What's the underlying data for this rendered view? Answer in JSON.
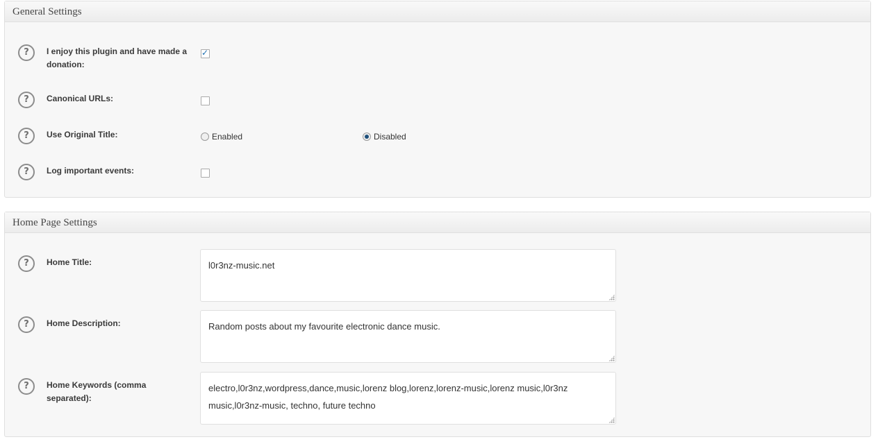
{
  "general": {
    "title": "General Settings",
    "donation": {
      "label": "I enjoy this plugin and have made a donation:",
      "checked": true
    },
    "canonical": {
      "label": "Canonical URLs:",
      "checked": false
    },
    "original_title": {
      "label": "Use Original Title:",
      "option_enabled": "Enabled",
      "option_disabled": "Disabled",
      "selected": "Disabled"
    },
    "log_events": {
      "label": "Log important events:",
      "checked": false
    }
  },
  "home": {
    "title": "Home Page Settings",
    "home_title": {
      "label": "Home Title:",
      "value": "l0r3nz-music.net"
    },
    "home_description": {
      "label": "Home Description:",
      "value": "Random posts about my favourite electronic dance music."
    },
    "home_keywords": {
      "label": "Home Keywords (comma separated):",
      "value": "electro,l0r3nz,wordpress,dance,music,lorenz blog,lorenz,lorenz-music,lorenz music,l0r3nz music,l0r3nz-music, techno, future techno"
    }
  },
  "icons": {
    "help": "?",
    "check": "✓"
  },
  "colors": {
    "checkmark": "#1e6fb0",
    "radio_selected": "#1d4f7a"
  }
}
